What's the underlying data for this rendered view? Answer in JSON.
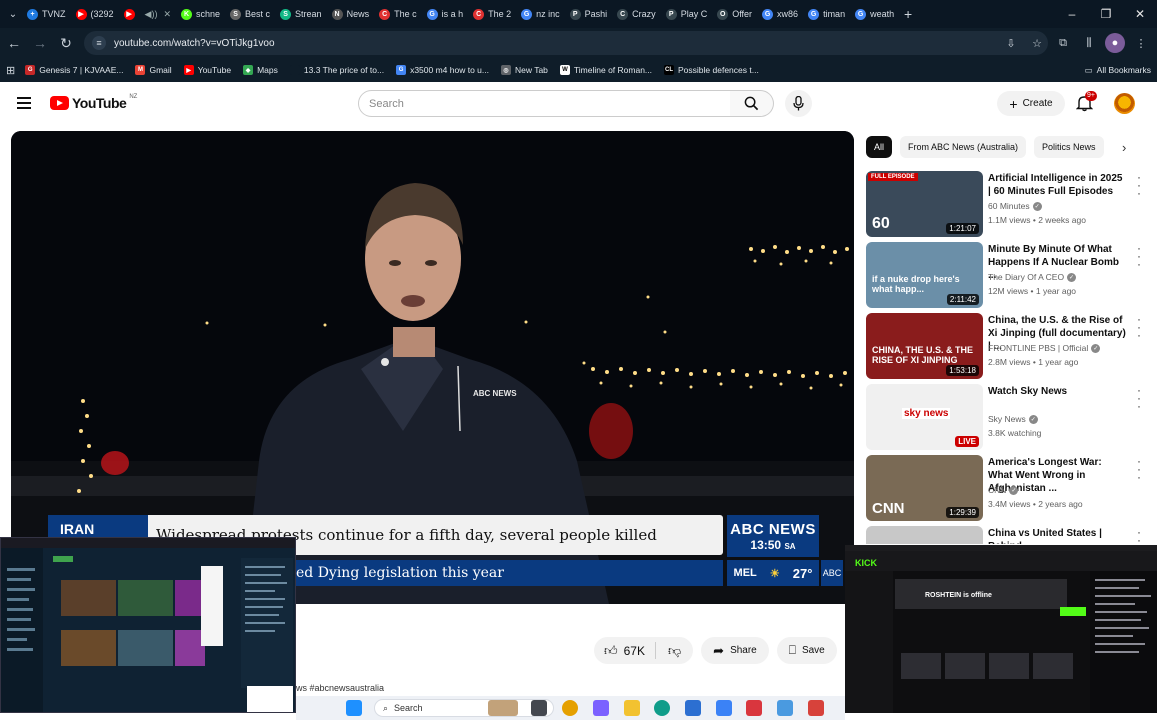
{
  "browser": {
    "tabs": [
      {
        "label": "TVNZ",
        "icon": "tvnz-favicon",
        "color": "#1f7ae0",
        "glyph": "+"
      },
      {
        "label": "(3292",
        "icon": "youtube-favicon",
        "color": "#ff0000",
        "glyph": "▶"
      },
      {
        "label": "",
        "icon": "youtube-favicon",
        "color": "#ff0000",
        "glyph": "▶"
      },
      {
        "label": "schne",
        "icon": "kick-favicon",
        "color": "#53fc18",
        "glyph": "K"
      },
      {
        "label": "Best c",
        "icon": "site-favicon",
        "color": "#666666",
        "glyph": "S"
      },
      {
        "label": "Strean",
        "icon": "stream-favicon",
        "color": "#12b886",
        "glyph": "S"
      },
      {
        "label": "News",
        "icon": "news-favicon",
        "color": "#555555",
        "glyph": "N"
      },
      {
        "label": "The c",
        "icon": "media-favicon",
        "color": "#e03131",
        "glyph": "C"
      },
      {
        "label": "is a h",
        "icon": "google-favicon",
        "color": "#4285f4",
        "glyph": "G"
      },
      {
        "label": "The 2",
        "icon": "media-favicon",
        "color": "#e03131",
        "glyph": "C"
      },
      {
        "label": "nz inc",
        "icon": "google-favicon",
        "color": "#4285f4",
        "glyph": "G"
      },
      {
        "label": "Pashi",
        "icon": "site-favicon",
        "color": "#37474f",
        "glyph": "P"
      },
      {
        "label": "Crazy",
        "icon": "site-favicon",
        "color": "#37474f",
        "glyph": "C"
      },
      {
        "label": "Play C",
        "icon": "site-favicon",
        "color": "#37474f",
        "glyph": "P"
      },
      {
        "label": "Offer",
        "icon": "site-favicon",
        "color": "#37474f",
        "glyph": "O"
      },
      {
        "label": "xw86",
        "icon": "google-favicon",
        "color": "#4285f4",
        "glyph": "G"
      },
      {
        "label": "timan",
        "icon": "google-favicon",
        "color": "#4285f4",
        "glyph": "G"
      },
      {
        "label": "weath",
        "icon": "google-favicon",
        "color": "#4285f4",
        "glyph": "G"
      }
    ],
    "url": "youtube.com/watch?v=vOTiJkg1voo",
    "bookmarks": [
      {
        "label": "Genesis 7 | KJVAAE...",
        "color": "#c62828",
        "glyph": "G"
      },
      {
        "label": "Gmail",
        "color": "#ea4335",
        "glyph": "M"
      },
      {
        "label": "YouTube",
        "color": "#ff0000",
        "glyph": "▶"
      },
      {
        "label": "Maps",
        "color": "#34a853",
        "glyph": "◆"
      },
      {
        "label": "13.3 The price of to...",
        "color": "#0f1d29",
        "glyph": ""
      },
      {
        "label": "x3500 m4 how to u...",
        "color": "#4285f4",
        "glyph": "G"
      },
      {
        "label": "New Tab",
        "color": "#5f6368",
        "glyph": "◎"
      },
      {
        "label": "Timeline of Roman...",
        "color": "#ffffff",
        "glyph": "W"
      },
      {
        "label": "Possible defences t...",
        "color": "#000000",
        "glyph": "CL"
      }
    ],
    "all_bookmarks": "All Bookmarks"
  },
  "youtube": {
    "logo_text": "YouTube",
    "country": "NZ",
    "search_placeholder": "Search",
    "create_label": "Create",
    "notifications": "9+"
  },
  "video": {
    "ticker_tag": "IRAN",
    "headline": "Widespread protests continue for a fifth day, several people killed",
    "subline": "ed Dying legislation this year",
    "network": "ABC NEWS",
    "time": "13:50",
    "time_zone": "SA",
    "city": "MEL",
    "temp": "27°",
    "corner": "ABC",
    "jacket_logo": "ABC NEWS"
  },
  "actions": {
    "likes": "67K",
    "share": "Share",
    "save": "Save"
  },
  "description_snippet": "ws #abcnewsaustralia",
  "chips": [
    {
      "label": "All",
      "active": true
    },
    {
      "label": "From ABC News (Australia)",
      "active": false
    },
    {
      "label": "Politics News",
      "active": false
    }
  ],
  "recommendations": [
    {
      "title": "Artificial Intelligence in 2025 | 60 Minutes Full Episodes",
      "channel": "60 Minutes",
      "meta": "1.1M views • 2 weeks ago",
      "duration": "1:21:07",
      "badge": "FULL EPISODE",
      "thumb_text": "60",
      "thumb_color": "#3a4a5a"
    },
    {
      "title": "Minute By Minute Of What Happens If A Nuclear Bomb ...",
      "channel": "The Diary Of A CEO",
      "meta": "12M views • 1 year ago",
      "duration": "2:11:42",
      "badge": "",
      "thumb_text": "if a nuke drop here's what happ...",
      "thumb_color": "#6b8fa8"
    },
    {
      "title": "China, the U.S. & the Rise of Xi Jinping (full documentary) | ...",
      "channel": "FRONTLINE PBS | Official",
      "meta": "2.8M views • 1 year ago",
      "duration": "1:53:18",
      "badge": "",
      "thumb_text": "CHINA, THE U.S. & THE RISE OF XI JINPING",
      "thumb_color": "#8a1c1c"
    },
    {
      "title": "Watch Sky News",
      "channel": "Sky News",
      "meta": "3.8K watching",
      "duration": "LIVE",
      "badge": "",
      "thumb_text": "sky news",
      "thumb_color": "#f0f0f0"
    },
    {
      "title": "America's Longest War: What Went Wrong in Afghanistan ...",
      "channel": "CNN",
      "meta": "3.4M views • 2 years ago",
      "duration": "1:29:39",
      "badge": "",
      "thumb_text": "CNN",
      "thumb_color": "#7a6a55"
    },
    {
      "title": "China vs United States | Behind",
      "channel": "",
      "meta": "",
      "duration": "",
      "badge": "",
      "thumb_text": "",
      "thumb_color": "#c8c8c8"
    }
  ],
  "overlay_right": {
    "channel_status": "ROSHTEIN is offline"
  },
  "taskbar": {
    "search": "Search"
  }
}
